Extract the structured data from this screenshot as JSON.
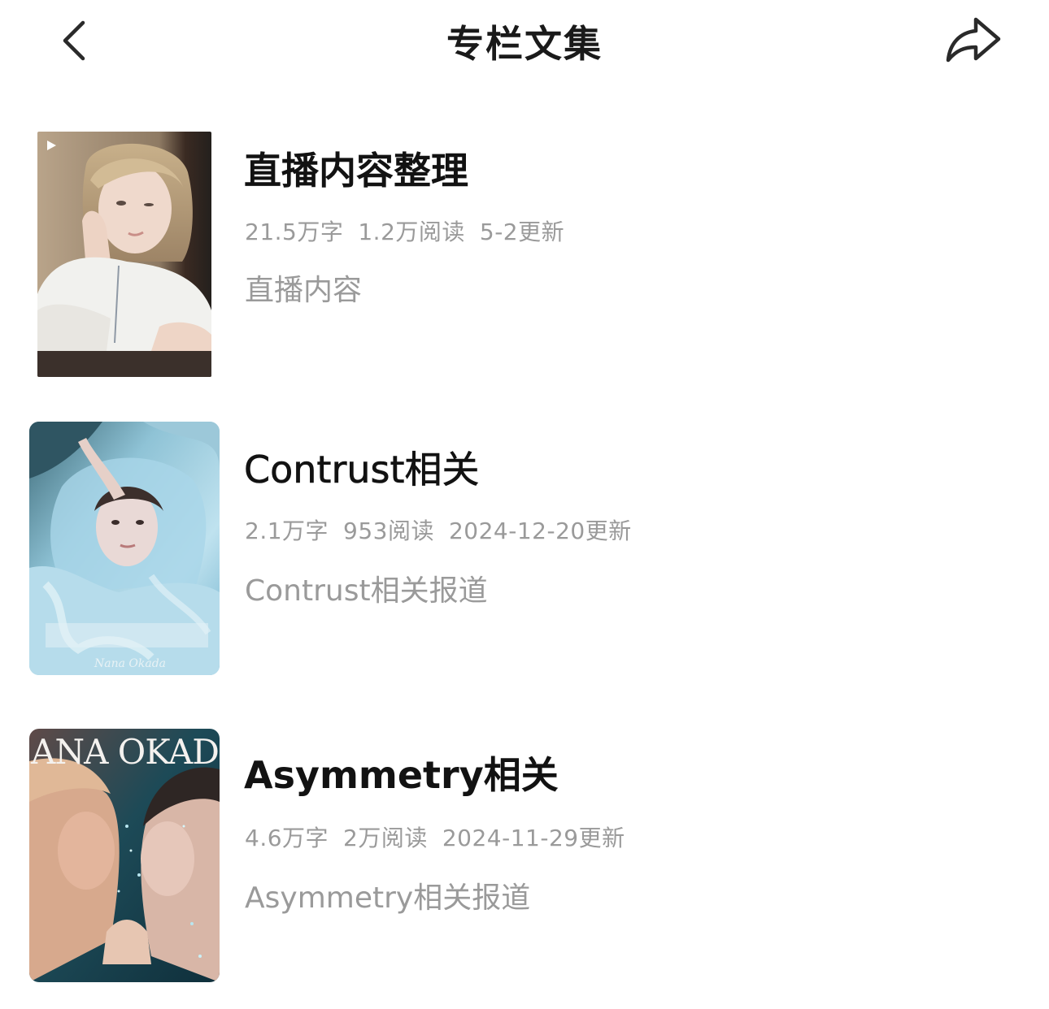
{
  "header": {
    "title": "专栏文集",
    "back_icon": "chevron-left-icon",
    "share_icon": "share-arrow-icon"
  },
  "collections": [
    {
      "title": "直播内容整理",
      "words": "21.5万字",
      "reads": "1.2万阅读",
      "updated": "5-2更新",
      "description": "直播内容",
      "cover_icon": "play-icon"
    },
    {
      "title": "Contrust相关",
      "words": "2.1万字",
      "reads": "953阅读",
      "updated": "2024-12-20更新",
      "description": "Contrust相关报道",
      "cover_signature": "Nana Okada"
    },
    {
      "title": "Asymmetry相关",
      "words": "4.6万字",
      "reads": "2万阅读",
      "updated": "2024-11-29更新",
      "description": "Asymmetry相关报道",
      "cover_text": "ANA OKAD"
    }
  ]
}
